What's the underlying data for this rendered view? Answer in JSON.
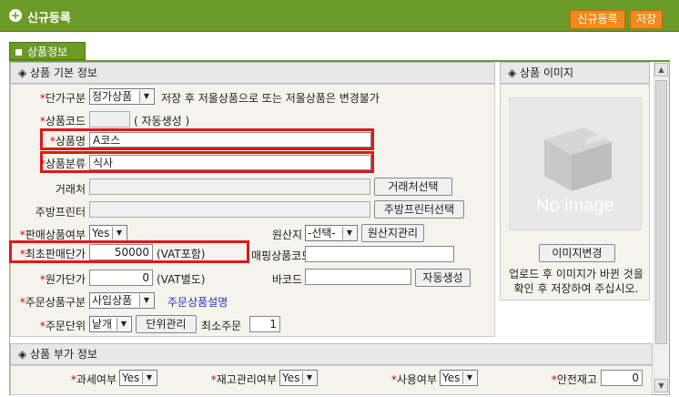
{
  "header": {
    "title": "신규등록",
    "btn_new": "신규등록",
    "btn_save": "저장"
  },
  "tab": {
    "label": "상품정보"
  },
  "basic": {
    "section_title": "◈ 상품 기본 정보",
    "unit_type_label": "단가구분",
    "unit_type_value": "정가상품",
    "unit_type_note": "저장 후 저울상품으로 또는 저울상품은 변경불가",
    "code_label": "상품코드",
    "code_note": "( 자동생성 )",
    "name_label": "상품명",
    "name_value": "A코스",
    "category_label": "상품분류",
    "category_value": "식사",
    "vendor_label": "거래처",
    "vendor_btn": "거래처선택",
    "printer_label": "주방프린터",
    "printer_btn": "주방프린터선택",
    "sale_label": "판매상품여부",
    "sale_value": "Yes",
    "origin_label": "원산지",
    "origin_value": "-선택-",
    "origin_btn": "원산지관리",
    "min_price_label": "최초판매단가",
    "min_price_value": "50000",
    "min_price_note": "(VAT포함)",
    "mapping_label": "매핑상품코드",
    "cost_label": "원가단가",
    "cost_value": "0",
    "cost_note": "(VAT별도)",
    "barcode_label": "바코드",
    "barcode_btn": "자동생성",
    "order_type_label": "주문상품구분",
    "order_type_value": "사입상품",
    "order_type_link": "주문상품설명",
    "order_unit_label": "주문단위",
    "order_unit_value": "낱개",
    "order_unit_btn": "단위관리",
    "min_order_label": "최소주문",
    "min_order_value": "1"
  },
  "image": {
    "section_title": "◈ 상품 이미지",
    "placeholder_text": "No image",
    "change_btn": "이미지변경",
    "note": "업로드 후 이미지가 바뀐 것을 확인 후 저장하여 주십시오."
  },
  "extra": {
    "section_title": "◈ 상품 부가 정보",
    "tax_label": "과세여부",
    "tax_value": "Yes",
    "stock_label": "재고관리여부",
    "stock_value": "Yes",
    "use_label": "사용여부",
    "use_value": "Yes",
    "safety_label": "안전재고",
    "safety_value": "0"
  },
  "colors": {
    "header_green": "#6c9a27",
    "accent_orange": "#f08a1c",
    "highlight_red": "#e01818"
  }
}
